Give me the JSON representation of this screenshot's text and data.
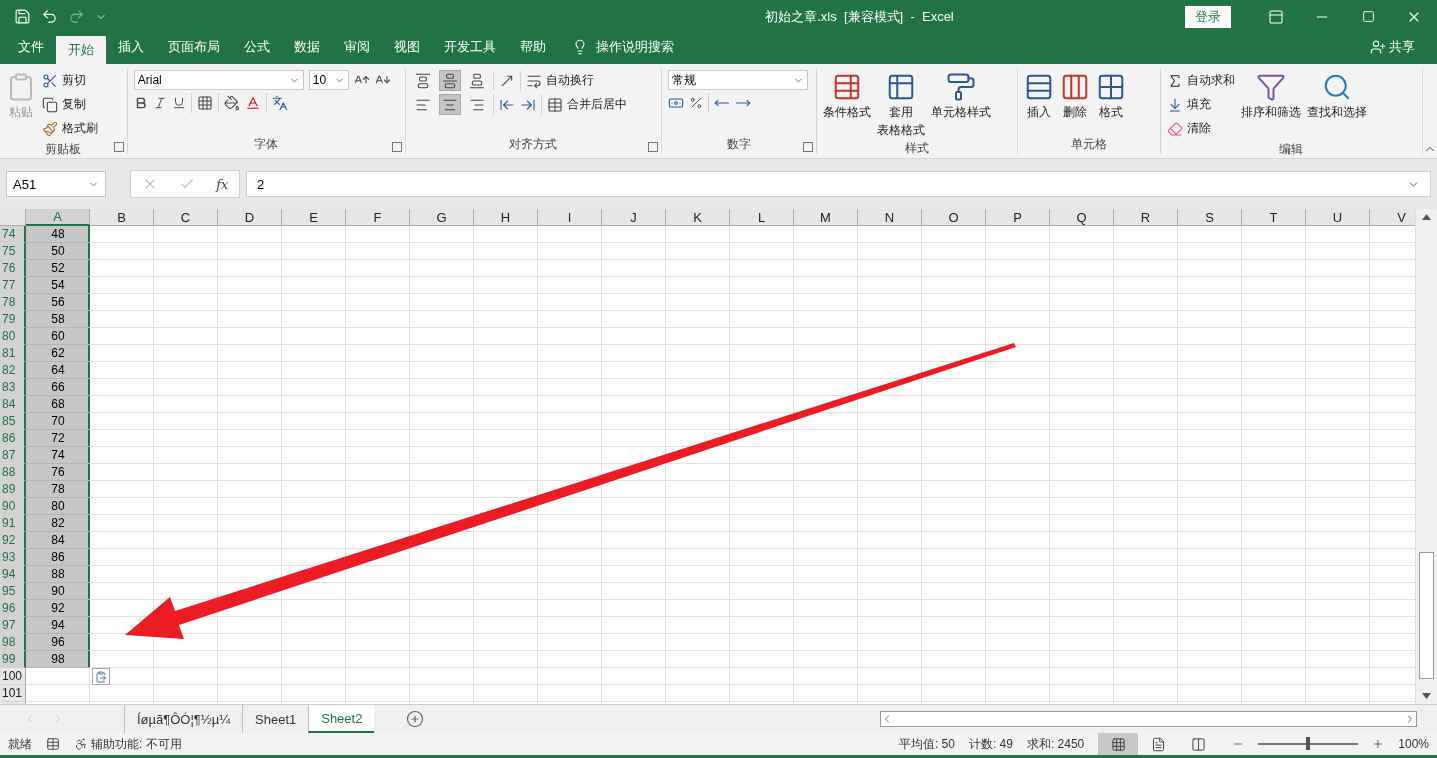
{
  "title_bar": {
    "title": "初始之章.xls  [兼容模式]  -  Excel",
    "sign_in": "登录"
  },
  "menu_tabs": [
    {
      "label": "文件",
      "selected": false
    },
    {
      "label": "开始",
      "selected": true
    },
    {
      "label": "插入",
      "selected": false
    },
    {
      "label": "页面布局",
      "selected": false
    },
    {
      "label": "公式",
      "selected": false
    },
    {
      "label": "数据",
      "selected": false
    },
    {
      "label": "审阅",
      "selected": false
    },
    {
      "label": "视图",
      "selected": false
    },
    {
      "label": "开发工具",
      "selected": false
    },
    {
      "label": "帮助",
      "selected": false
    }
  ],
  "tell_me": "操作说明搜索",
  "share": "共享",
  "ribbon": {
    "clipboard": {
      "label": "剪贴板",
      "paste": {
        "label": "粘贴",
        "disabled": true
      },
      "cut": "剪切",
      "copy": "复制",
      "format_painter": "格式刷"
    },
    "font": {
      "label": "字体",
      "font_name": "Arial",
      "font_size": "10"
    },
    "alignment": {
      "label": "对齐方式",
      "wrap_text": "自动换行",
      "merge_center": "合并后居中"
    },
    "number": {
      "label": "数字",
      "format": "常规"
    },
    "styles": {
      "label": "样式",
      "conditional": "条件格式",
      "table_format": [
        "套用",
        "表格格式"
      ],
      "cell_styles": "单元格样式"
    },
    "cells": {
      "label": "单元格",
      "insert": "插入",
      "delete": "删除",
      "format": "格式"
    },
    "editing": {
      "label": "编辑",
      "autosum": "自动求和",
      "fill": "填充",
      "clear": "清除",
      "sort_filter": "排序和筛选",
      "find_select": "查找和选择"
    }
  },
  "formula_bar": {
    "name_box": "A51",
    "function_button": "fx",
    "value": "2"
  },
  "grid": {
    "columns": [
      {
        "label": "A",
        "selected": true
      },
      {
        "label": "B",
        "selected": false
      },
      {
        "label": "C",
        "selected": false
      },
      {
        "label": "D",
        "selected": false
      },
      {
        "label": "E",
        "selected": false
      },
      {
        "label": "F",
        "selected": false
      },
      {
        "label": "G",
        "selected": false
      },
      {
        "label": "H",
        "selected": false
      },
      {
        "label": "I",
        "selected": false
      },
      {
        "label": "J",
        "selected": false
      },
      {
        "label": "K",
        "selected": false
      },
      {
        "label": "L",
        "selected": false
      },
      {
        "label": "M",
        "selected": false
      },
      {
        "label": "N",
        "selected": false
      },
      {
        "label": "O",
        "selected": false
      },
      {
        "label": "P",
        "selected": false
      },
      {
        "label": "Q",
        "selected": false
      },
      {
        "label": "R",
        "selected": false
      },
      {
        "label": "S",
        "selected": false
      },
      {
        "label": "T",
        "selected": false
      },
      {
        "label": "U",
        "selected": false
      },
      {
        "label": "V",
        "selected": false
      }
    ],
    "rows": [
      {
        "number": "74",
        "value": "48",
        "selected": true
      },
      {
        "number": "75",
        "value": "50",
        "selected": true
      },
      {
        "number": "76",
        "value": "52",
        "selected": true
      },
      {
        "number": "77",
        "value": "54",
        "selected": true
      },
      {
        "number": "78",
        "value": "56",
        "selected": true
      },
      {
        "number": "79",
        "value": "58",
        "selected": true
      },
      {
        "number": "80",
        "value": "60",
        "selected": true
      },
      {
        "number": "81",
        "value": "62",
        "selected": true
      },
      {
        "number": "82",
        "value": "64",
        "selected": true
      },
      {
        "number": "83",
        "value": "66",
        "selected": true
      },
      {
        "number": "84",
        "value": "68",
        "selected": true
      },
      {
        "number": "85",
        "value": "70",
        "selected": true
      },
      {
        "number": "86",
        "value": "72",
        "selected": true
      },
      {
        "number": "87",
        "value": "74",
        "selected": true
      },
      {
        "number": "88",
        "value": "76",
        "selected": true
      },
      {
        "number": "89",
        "value": "78",
        "selected": true
      },
      {
        "number": "90",
        "value": "80",
        "selected": true
      },
      {
        "number": "91",
        "value": "82",
        "selected": true
      },
      {
        "number": "92",
        "value": "84",
        "selected": true
      },
      {
        "number": "93",
        "value": "86",
        "selected": true
      },
      {
        "number": "94",
        "value": "88",
        "selected": true
      },
      {
        "number": "95",
        "value": "90",
        "selected": true
      },
      {
        "number": "96",
        "value": "92",
        "selected": true
      },
      {
        "number": "97",
        "value": "94",
        "selected": true
      },
      {
        "number": "98",
        "value": "96",
        "selected": true
      },
      {
        "number": "99",
        "value": "98",
        "selected": true
      },
      {
        "number": "100",
        "selected": false
      },
      {
        "number": "101",
        "selected": false
      }
    ]
  },
  "sheet_tabs": [
    {
      "label": "Íøµã¶ÔÓ¦¶½µ¼",
      "selected": false
    },
    {
      "label": "Sheet1",
      "selected": false
    },
    {
      "label": "Sheet2",
      "selected": true
    }
  ],
  "status_bar": {
    "ready": "就绪",
    "accessibility": "辅助功能: 不可用",
    "stats": [
      "平均值: 50",
      "计数: 49",
      "求和: 2450"
    ],
    "views": [
      {
        "kind": "normal",
        "selected": true
      },
      {
        "kind": "page_layout",
        "selected": false
      },
      {
        "kind": "page_break",
        "selected": false
      }
    ],
    "zoom": {
      "level": 0.5,
      "reading": "100%"
    }
  }
}
